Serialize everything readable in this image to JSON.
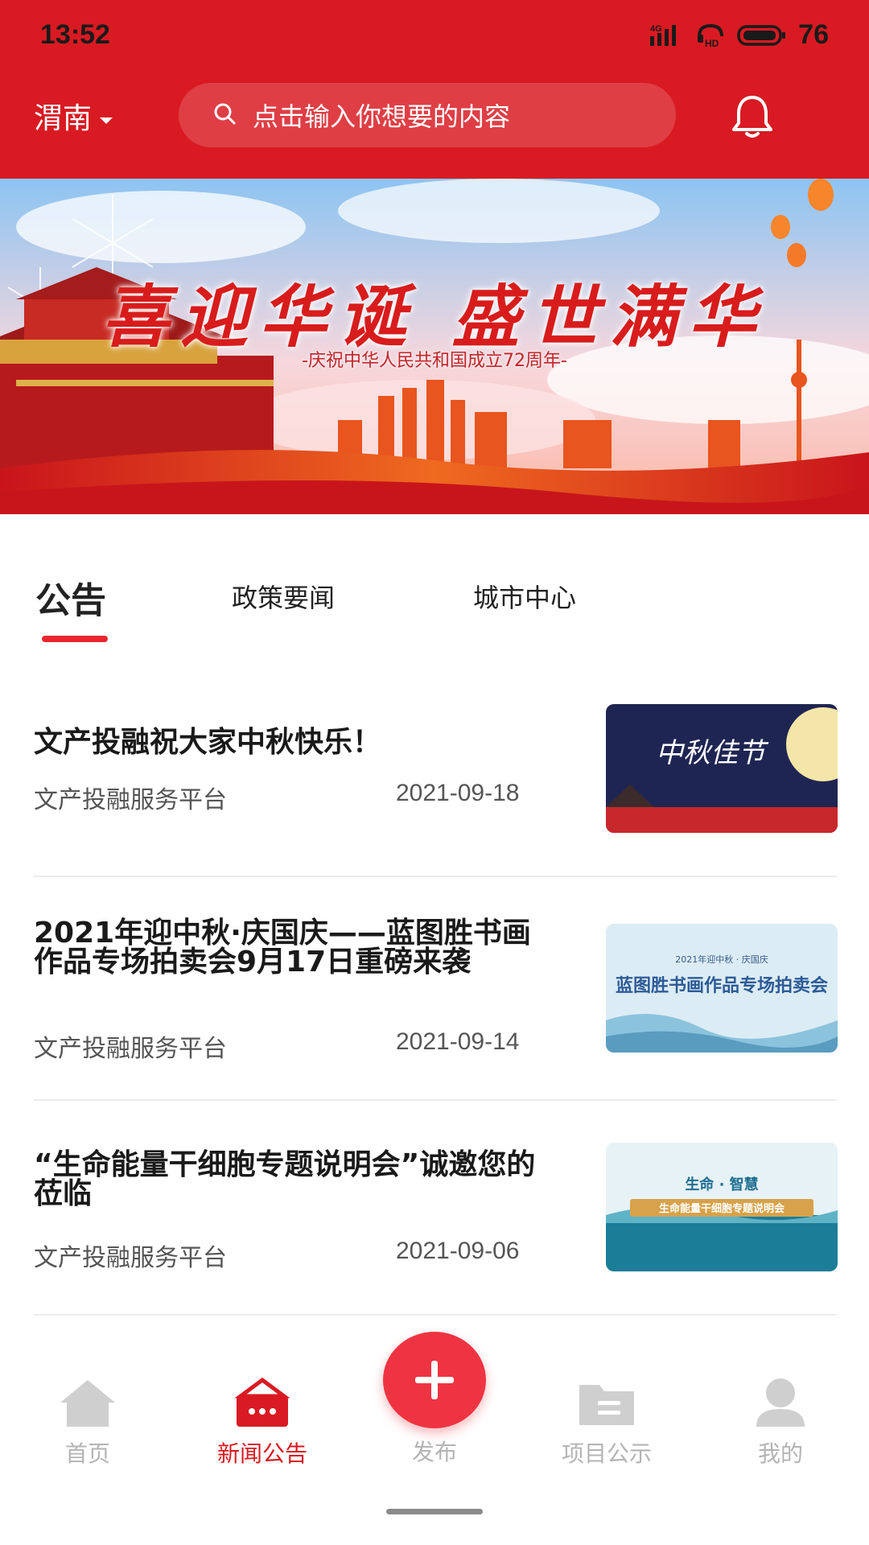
{
  "status_bar": {
    "time": "13:52",
    "network": "4G",
    "hd_label": "HD",
    "battery": "76"
  },
  "header": {
    "city": "渭南",
    "search_placeholder": "点击输入你想要的内容",
    "bell_icon": "bell-icon"
  },
  "banner": {
    "title": "喜迎华诞 盛世满华",
    "subtitle": "-庆祝中华人民共和国成立72周年-"
  },
  "tabs": [
    {
      "label": "公告",
      "active": true
    },
    {
      "label": "政策要闻",
      "active": false
    },
    {
      "label": "城市中心",
      "active": false
    }
  ],
  "news": [
    {
      "title": "文产投融祝大家中秋快乐！",
      "source": "文产投融服务平台",
      "date": "2021-09-18",
      "thumb_text": "中秋佳节"
    },
    {
      "title": "2021年迎中秋·庆国庆——蓝图胜书画作品专场拍卖会9月17日重磅来袭",
      "source": "文产投融服务平台",
      "date": "2021-09-14",
      "thumb_text": "蓝图胜书画作品专场拍卖会",
      "thumb_top": "2021年迎中秋 · 庆国庆"
    },
    {
      "title": "“生命能量干细胞专题说明会”诚邀您的莅临",
      "source": "文产投融服务平台",
      "date": "2021-09-06",
      "thumb_text": "生命 · 智慧",
      "thumb_sub": "生命能量干细胞专题说明会"
    }
  ],
  "bottom_nav": [
    {
      "label": "首页",
      "icon": "home-icon",
      "active": false
    },
    {
      "label": "新闻公告",
      "icon": "news-icon",
      "active": true
    },
    {
      "label": "发布",
      "icon": "plus-icon",
      "active": false
    },
    {
      "label": "项目公示",
      "icon": "folder-icon",
      "active": false
    },
    {
      "label": "我的",
      "icon": "user-icon",
      "active": false
    }
  ],
  "colors": {
    "brand_red": "#d91a22",
    "publish_red": "#ee3442",
    "inactive_gray": "#b4b4b4"
  }
}
